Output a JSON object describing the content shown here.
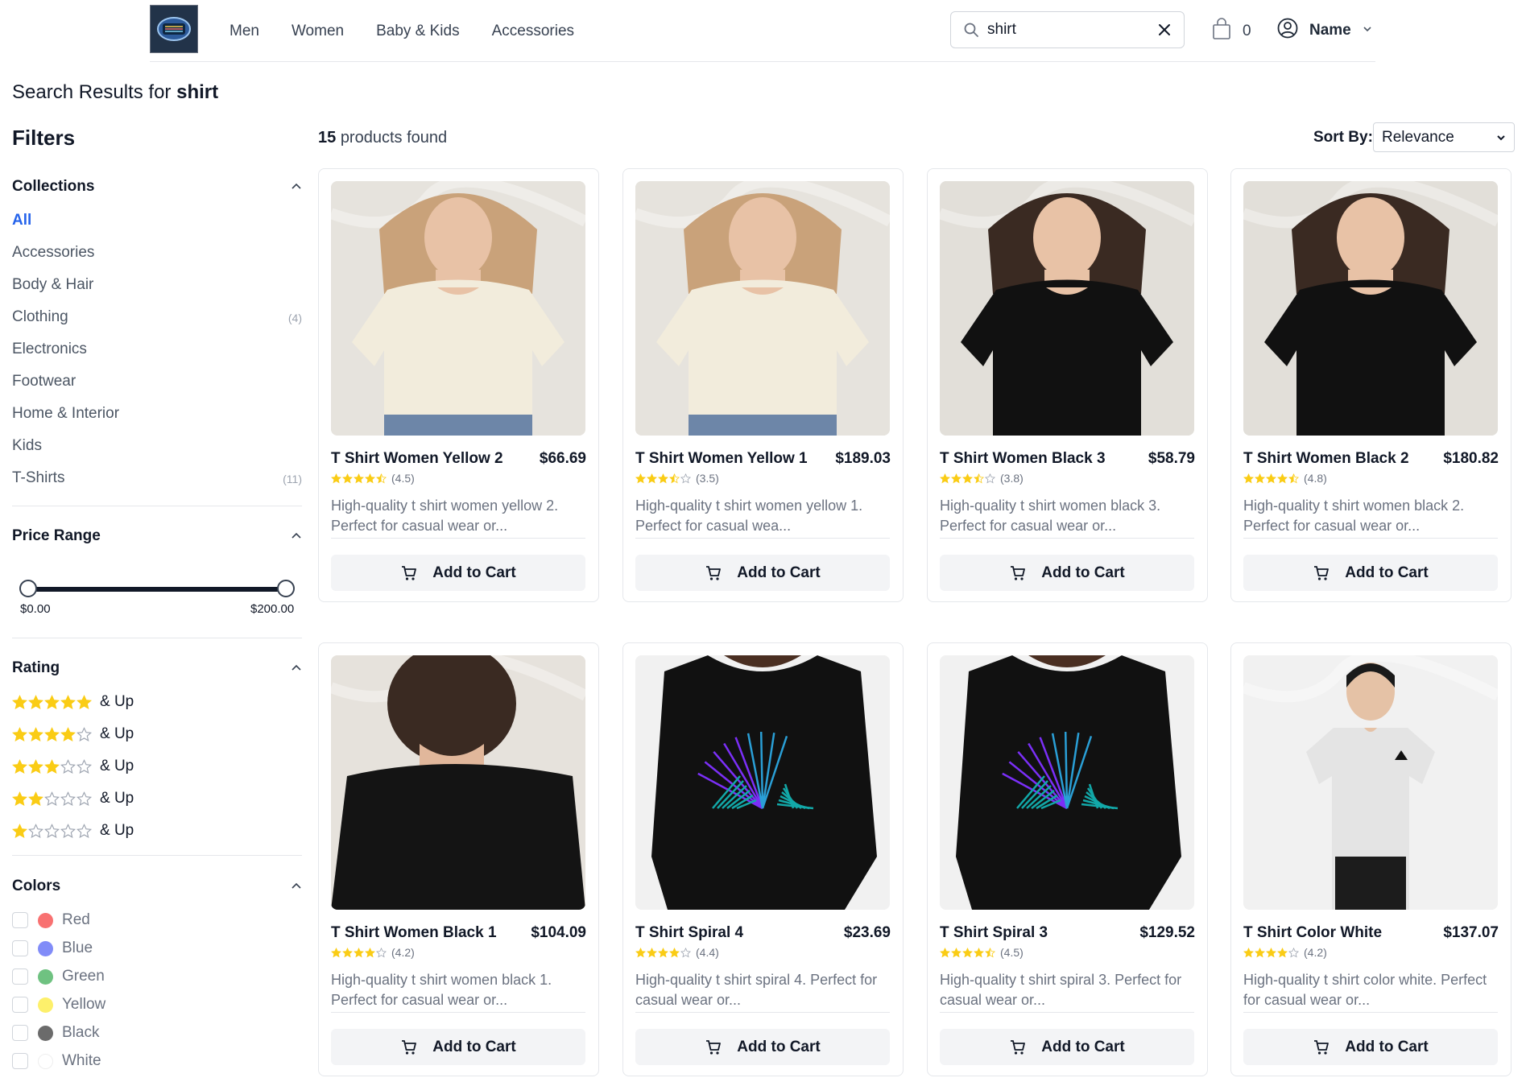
{
  "header": {
    "nav": [
      "Men",
      "Women",
      "Baby & Kids",
      "Accessories"
    ],
    "search_value": "shirt",
    "cart_count": "0",
    "user_name": "Name"
  },
  "page": {
    "title_prefix": "Search Results for",
    "query": "shirt",
    "found_count": "15",
    "found_text": "products found",
    "sort_label": "Sort By:",
    "sort_value": "Relevance"
  },
  "filters": {
    "title": "Filters",
    "collections": {
      "heading": "Collections",
      "items": [
        {
          "label": "All",
          "count": ""
        },
        {
          "label": "Accessories",
          "count": ""
        },
        {
          "label": "Body & Hair",
          "count": ""
        },
        {
          "label": "Clothing",
          "count": "(4)"
        },
        {
          "label": "Electronics",
          "count": ""
        },
        {
          "label": "Footwear",
          "count": ""
        },
        {
          "label": "Home & Interior",
          "count": ""
        },
        {
          "label": "Kids",
          "count": ""
        },
        {
          "label": "T-Shirts",
          "count": "(11)"
        }
      ]
    },
    "price": {
      "heading": "Price Range",
      "min_label": "$0.00",
      "max_label": "$200.00"
    },
    "rating": {
      "heading": "Rating",
      "suffix": "& Up",
      "levels": [
        5,
        4,
        3,
        2,
        1
      ]
    },
    "colors": {
      "heading": "Colors",
      "items": [
        {
          "label": "Red",
          "hex": "#f87171"
        },
        {
          "label": "Blue",
          "hex": "#818cf8"
        },
        {
          "label": "Green",
          "hex": "#6fc281"
        },
        {
          "label": "Yellow",
          "hex": "#fdf06b"
        },
        {
          "label": "Black",
          "hex": "#6b6b6b"
        },
        {
          "label": "White",
          "hex": "#ffffff"
        }
      ]
    }
  },
  "products": [
    {
      "name": "T Shirt Women Yellow 2",
      "price": "$66.69",
      "rating": 4.5,
      "rating_text": "(4.5)",
      "desc": "High-quality t shirt women yellow 2. Perfect for casual wear or...",
      "shirt": "cream",
      "add": "Add to Cart"
    },
    {
      "name": "T Shirt Women Yellow 1",
      "price": "$189.03",
      "rating": 3.5,
      "rating_text": "(3.5)",
      "desc": "High-quality t shirt women yellow 1. Perfect for casual wea...",
      "shirt": "cream",
      "add": "Add to Cart"
    },
    {
      "name": "T Shirt Women Black 3",
      "price": "$58.79",
      "rating": 3.8,
      "rating_text": "(3.8)",
      "desc": "High-quality t shirt women black 3. Perfect for casual wear or...",
      "shirt": "black",
      "add": "Add to Cart"
    },
    {
      "name": "T Shirt Women Black 2",
      "price": "$180.82",
      "rating": 4.8,
      "rating_text": "(4.8)",
      "desc": "High-quality t shirt women black 2. Perfect for casual wear or...",
      "shirt": "black",
      "add": "Add to Cart"
    },
    {
      "name": "T Shirt Women Black 1",
      "price": "$104.09",
      "rating": 4.2,
      "rating_text": "(4.2)",
      "desc": "High-quality t shirt women black 1. Perfect for casual wear or...",
      "shirt": "black-back",
      "add": "Add to Cart"
    },
    {
      "name": "T Shirt Spiral 4",
      "price": "$23.69",
      "rating": 4.4,
      "rating_text": "(4.4)",
      "desc": "High-quality t shirt spiral 4. Perfect for casual wear or...",
      "shirt": "spiral",
      "add": "Add to Cart"
    },
    {
      "name": "T Shirt Spiral 3",
      "price": "$129.52",
      "rating": 4.5,
      "rating_text": "(4.5)",
      "desc": "High-quality t shirt spiral 3. Perfect for casual wear or...",
      "shirt": "spiral",
      "add": "Add to Cart"
    },
    {
      "name": "T Shirt Color White",
      "price": "$137.07",
      "rating": 4.2,
      "rating_text": "(4.2)",
      "desc": "High-quality t shirt color white. Perfect for casual wear or...",
      "shirt": "white",
      "add": "Add to Cart"
    }
  ],
  "colors": {
    "star": "#facc15",
    "star_empty": "#9ca3af",
    "accent": "#2563eb"
  }
}
